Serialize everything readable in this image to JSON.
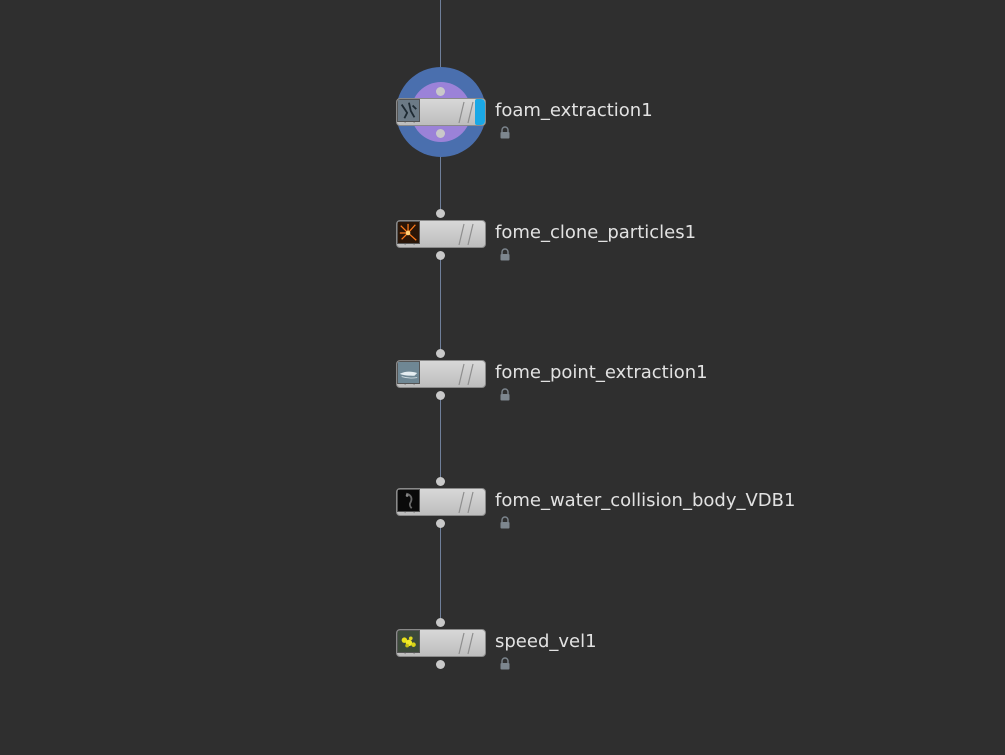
{
  "network": {
    "nodes": [
      {
        "name": "foam_extraction1",
        "thumbnail": "water-splash-thumbnail",
        "display_flag": true,
        "selected": true
      },
      {
        "name": "fome_clone_particles1",
        "thumbnail": "orange-particles-thumbnail",
        "display_flag": false,
        "selected": false
      },
      {
        "name": "fome_point_extraction1",
        "thumbnail": "boat-wake-thumbnail",
        "display_flag": false,
        "selected": false
      },
      {
        "name": "fome_water_collision_body_VDB1",
        "thumbnail": "dark-volume-thumbnail",
        "display_flag": false,
        "selected": false
      },
      {
        "name": "speed_vel1",
        "thumbnail": "yellow-points-thumbnail",
        "display_flag": false,
        "selected": false
      }
    ],
    "colors": {
      "background": "#2f2f2f",
      "wire": "#6f7f9a",
      "node_body": "#cfcfcf",
      "display_flag": "#1aa8e6",
      "selection_halo_outer": "#4a6fae",
      "selection_halo_inner": "#9b82d8",
      "label": "#e2e2e2"
    },
    "icons": [
      "lock-icon"
    ]
  }
}
